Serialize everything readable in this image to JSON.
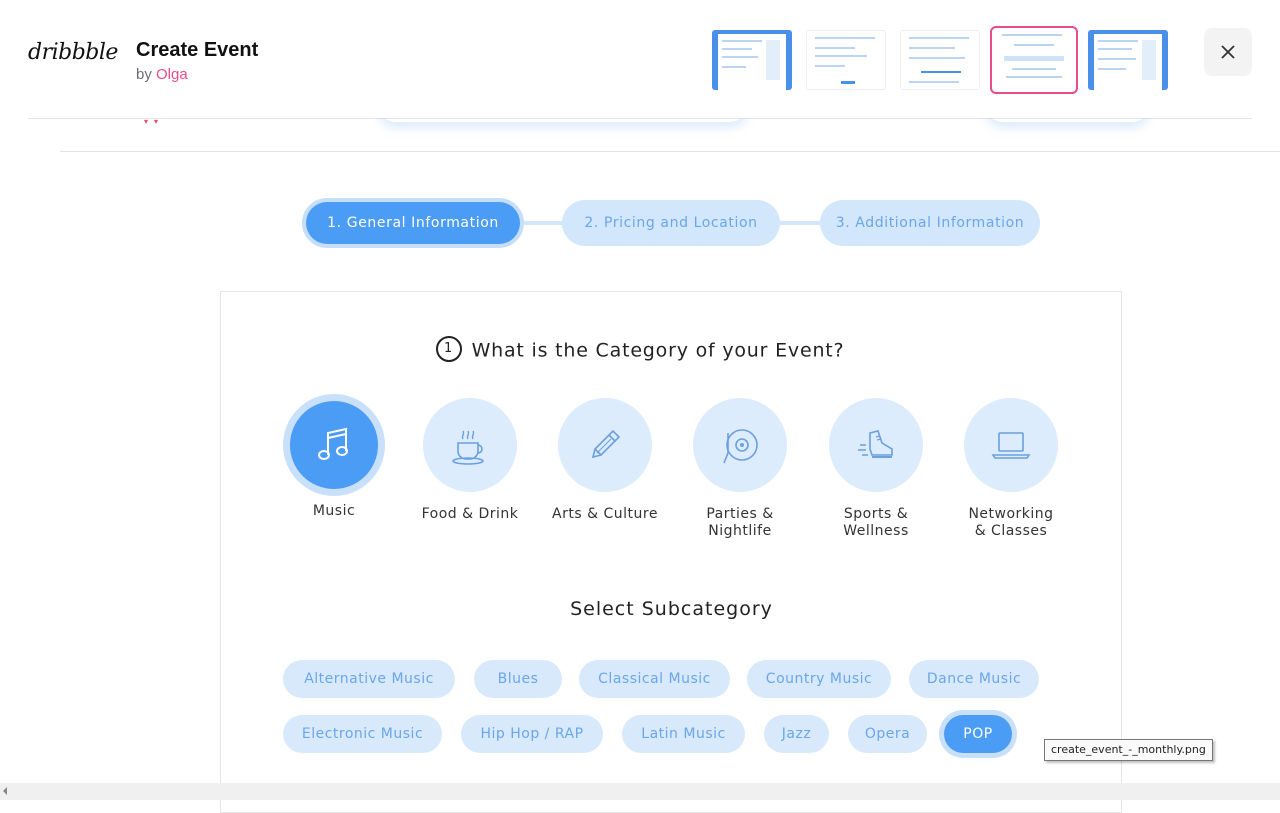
{
  "header": {
    "logo": "dribbble",
    "shot_title": "Create Event",
    "by_prefix": "by",
    "author": "Olga",
    "close_label": "Close"
  },
  "stepper": {
    "steps": [
      {
        "label": "1. General Information",
        "active": true
      },
      {
        "label": "2. Pricing and Location",
        "active": false
      },
      {
        "label": "3. Additional Information",
        "active": false
      }
    ]
  },
  "question": {
    "number": "1",
    "title": "What is the Category of your Event?"
  },
  "categories": [
    {
      "label": "Music",
      "icon": "music-note-icon",
      "selected": true
    },
    {
      "label": "Food & Drink",
      "icon": "coffee-cup-icon",
      "selected": false
    },
    {
      "label": "Arts & Culture",
      "icon": "pencil-icon",
      "selected": false
    },
    {
      "label": "Parties & Nightlife",
      "line1": "Parties &",
      "line2": "Nightlife",
      "icon": "vinyl-record-icon",
      "selected": false
    },
    {
      "label": "Sports & Wellness",
      "line1": "Sports &",
      "line2": "Wellness",
      "icon": "sneaker-icon",
      "selected": false
    },
    {
      "label": "Networking & Classes",
      "line1": "Networking",
      "line2": "& Classes",
      "icon": "laptop-icon",
      "selected": false
    }
  ],
  "subcategory": {
    "title": "Select Subcategory",
    "chips": [
      {
        "label": "Alternative Music",
        "selected": false
      },
      {
        "label": "Blues",
        "selected": false
      },
      {
        "label": "Classical Music",
        "selected": false
      },
      {
        "label": "Country Music",
        "selected": false
      },
      {
        "label": "Dance Music",
        "selected": false
      },
      {
        "label": "Electronic Music",
        "selected": false
      },
      {
        "label": "Hip Hop / RAP",
        "selected": false
      },
      {
        "label": "Latin Music",
        "selected": false
      },
      {
        "label": "Jazz",
        "selected": false
      },
      {
        "label": "Opera",
        "selected": false
      },
      {
        "label": "POP",
        "selected": true
      }
    ]
  },
  "tooltip": "create_event_-_monthly.png",
  "colors": {
    "accent": "#4a9cf5",
    "accent_light": "#d8e9fb",
    "author_pink": "#ea4c89"
  }
}
